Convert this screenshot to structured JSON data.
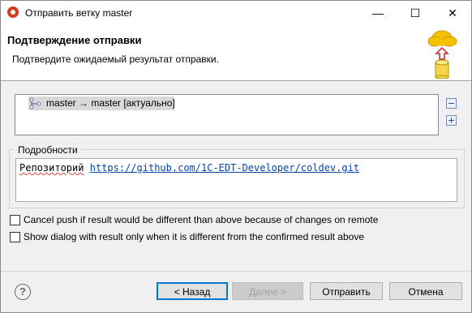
{
  "window": {
    "title": "Отправить ветку master",
    "controls": [
      "minimize-icon",
      "maximize-icon",
      "close-icon"
    ]
  },
  "header": {
    "title": "Подтверждение отправки",
    "description": "Подтвердите ожидаемый результат отправки.",
    "icon": "cloud-push-icon"
  },
  "refs": [
    {
      "icon": "branch-icon",
      "label": "master → master [актуально]"
    }
  ],
  "side_buttons": [
    "collapse-all-icon",
    "expand-all-icon"
  ],
  "details": {
    "group_label": "Подробности",
    "repo_label": "Репозиторий",
    "repo_url": "https://github.com/1C-EDT-Developer/coldev.git"
  },
  "options": [
    {
      "label": "Cancel push if result would be different than above because of changes on remote",
      "checked": false
    },
    {
      "label": "Show dialog with result only when it is different from the confirmed result above",
      "checked": false
    }
  ],
  "buttons": {
    "back": "< Назад",
    "next": "Далее >",
    "finish": "Отправить",
    "cancel": "Отмена"
  },
  "colors": {
    "link": "#0645ad",
    "default_button_border": "#0078d7",
    "app_icon": "#d23b1f"
  }
}
